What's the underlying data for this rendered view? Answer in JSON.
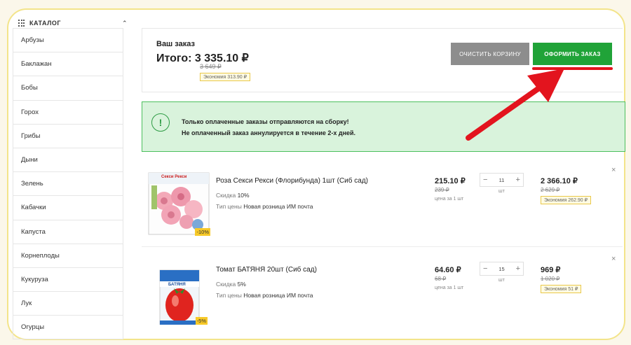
{
  "catalog": {
    "title": "КАТАЛОГ"
  },
  "sidebar": {
    "items": [
      {
        "label": "Арбузы"
      },
      {
        "label": "Баклажан"
      },
      {
        "label": "Бобы"
      },
      {
        "label": "Горох"
      },
      {
        "label": "Грибы"
      },
      {
        "label": "Дыни"
      },
      {
        "label": "Зелень"
      },
      {
        "label": "Кабачки"
      },
      {
        "label": "Капуста"
      },
      {
        "label": "Корнеплоды"
      },
      {
        "label": "Кукуруза"
      },
      {
        "label": "Лук"
      },
      {
        "label": "Огурцы"
      }
    ]
  },
  "order": {
    "label": "Ваш заказ",
    "total": "Итого: 3 335.10 ₽",
    "old_total": "3 649 ₽",
    "economy": "Экономия 313.90 ₽",
    "clear_label": "ОЧИСТИТЬ КОРЗИНУ",
    "submit_label": "ОФОРМИТЬ ЗАКАЗ"
  },
  "notice": {
    "line1": "Только оплаченные заказы отправляются на сборку!",
    "line2": "Не оплаченный заказ аннулируется в течение 2-х дней."
  },
  "products": [
    {
      "name": "Роза Секси Рекси (Флорибунда) 1шт (Сиб сад)",
      "discount_label": "Скидка",
      "discount": "10%",
      "price_type_label": "Тип цены",
      "price_type": "Новая розница ИМ почта",
      "price": "215.10 ₽",
      "old_price": "239 ₽",
      "unit_note": "цена за 1 шт",
      "qty": "11",
      "qty_unit": "шт",
      "sum": "2 366.10 ₽",
      "old_sum": "2 629 ₽",
      "economy": "Экономия 262.90 ₽",
      "badge": "-10%",
      "pack_title": "Секси Рекси"
    },
    {
      "name": "Томат БАТЯНЯ 20шт (Сиб сад)",
      "discount_label": "Скидка",
      "discount": "5%",
      "price_type_label": "Тип цены",
      "price_type": "Новая розница ИМ почта",
      "price": "64.60 ₽",
      "old_price": "68 ₽",
      "unit_note": "цена за 1 шт",
      "qty": "15",
      "qty_unit": "шт",
      "sum": "969 ₽",
      "old_sum": "1 020 ₽",
      "economy": "Экономия 51 ₽",
      "badge": "-5%",
      "pack_title": "БАТЯНЯ"
    }
  ],
  "icons": {
    "close": "×",
    "minus": "−",
    "plus": "+",
    "notice": "!"
  },
  "colors": {
    "accent_green": "#20a338",
    "arrow_red": "#e3141e",
    "badge_yellow": "#f7c928"
  }
}
